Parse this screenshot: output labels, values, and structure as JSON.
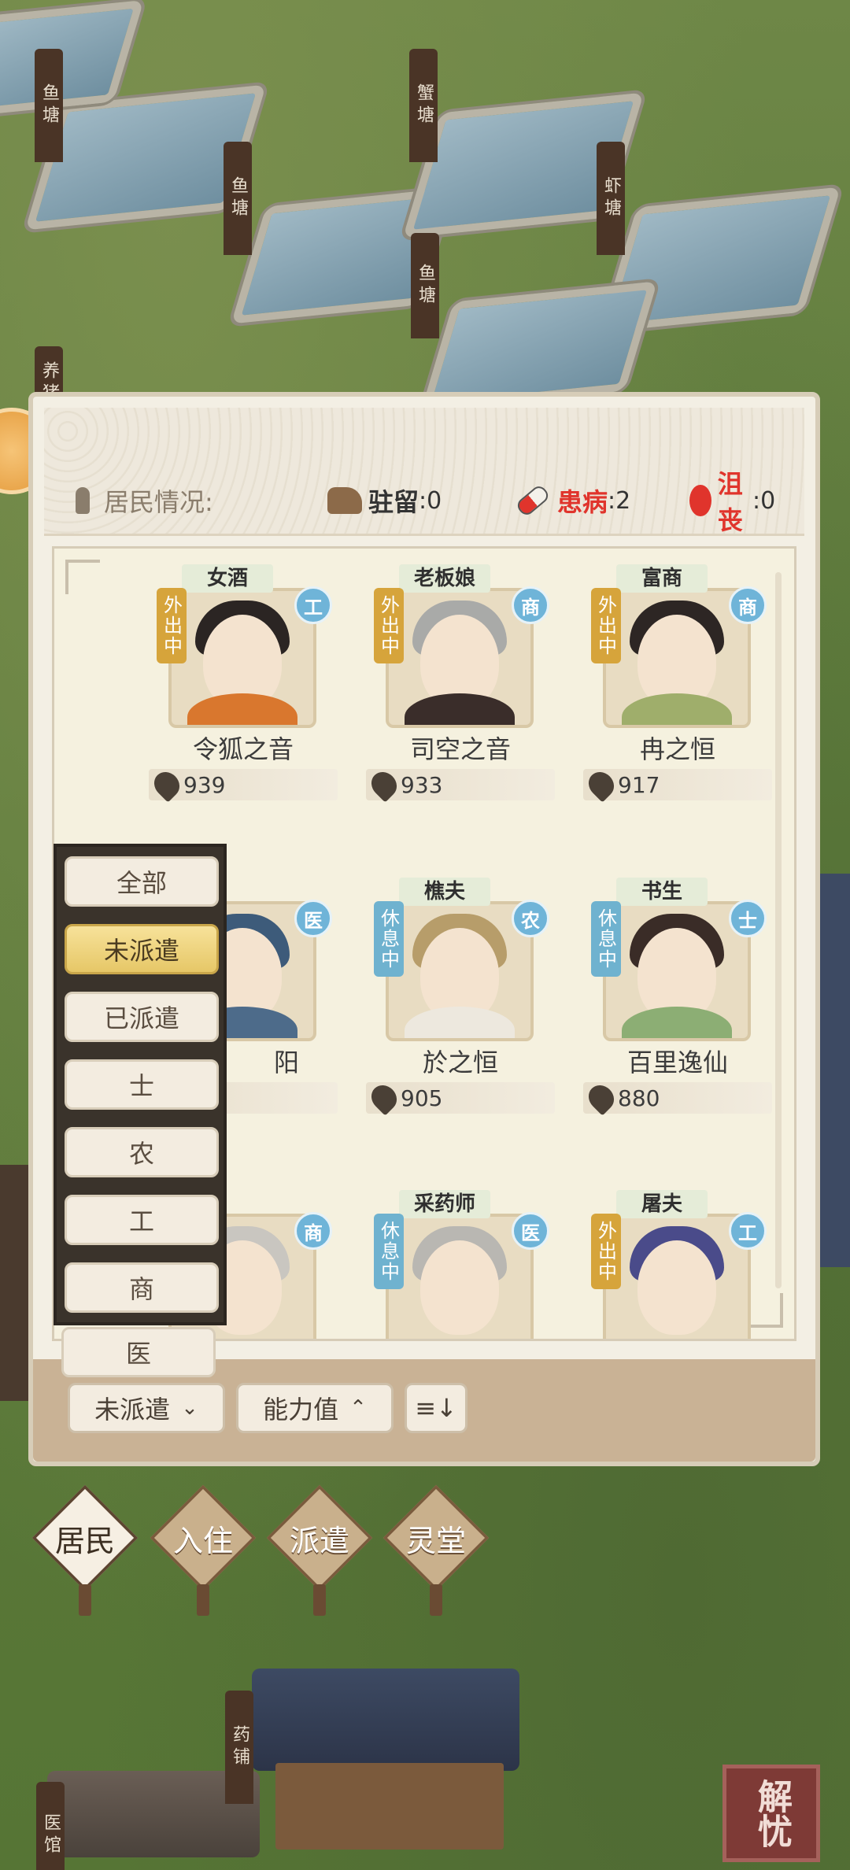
{
  "map": {
    "signs": [
      "鱼塘",
      "蟹塘",
      "鱼塘",
      "虾塘",
      "鱼塘",
      "养猪",
      "药铺",
      "医馆"
    ]
  },
  "status": {
    "label": "居民情况:",
    "stay": {
      "name": "驻留",
      "value": ":0"
    },
    "sick": {
      "name": "患病",
      "value": ":2"
    },
    "sad": {
      "name": "沮丧",
      "value": ":0"
    }
  },
  "residents": [
    {
      "role": "女酒",
      "name": "令狐之音",
      "power": "939",
      "status": "外出中",
      "class": "工",
      "status_color": "#d6a43b"
    },
    {
      "role": "老板娘",
      "name": "司空之音",
      "power": "933",
      "status": "外出中",
      "class": "商"
    },
    {
      "role": "富商",
      "name": "冉之恒",
      "power": "917",
      "status": "外出中",
      "class": "商"
    },
    {
      "role": "",
      "name": "阳",
      "power": "",
      "status": "",
      "class": "医"
    },
    {
      "role": "樵夫",
      "name": "於之恒",
      "power": "905",
      "status": "休息中",
      "class": "农"
    },
    {
      "role": "书生",
      "name": "百里逸仙",
      "power": "880",
      "status": "休息中",
      "class": "士"
    },
    {
      "role": "",
      "name": "",
      "power": "",
      "status": "",
      "class": "商"
    },
    {
      "role": "采药师",
      "name": "",
      "power": "",
      "status": "休息中",
      "class": "医"
    },
    {
      "role": "屠夫",
      "name": "",
      "power": "",
      "status": "外出中",
      "class": "工"
    }
  ],
  "dropdown": {
    "items": [
      "全部",
      "未派遣",
      "已派遣",
      "士",
      "农",
      "工",
      "商",
      "医"
    ],
    "selected": "未派遣"
  },
  "controls": {
    "filter_label": "未派遣",
    "sort_label": "能力值",
    "toggle_label": "≡↓"
  },
  "nav": {
    "tabs": [
      "居民",
      "入住",
      "派遣",
      "灵堂"
    ],
    "active": "居民"
  },
  "stamp": {
    "text": "解忧"
  },
  "colors": {
    "accent_red": "#e0342c",
    "class_badge": "#6fb4d8",
    "tag_out": "#d6a43b",
    "tag_rest": "#6fb2cf"
  }
}
